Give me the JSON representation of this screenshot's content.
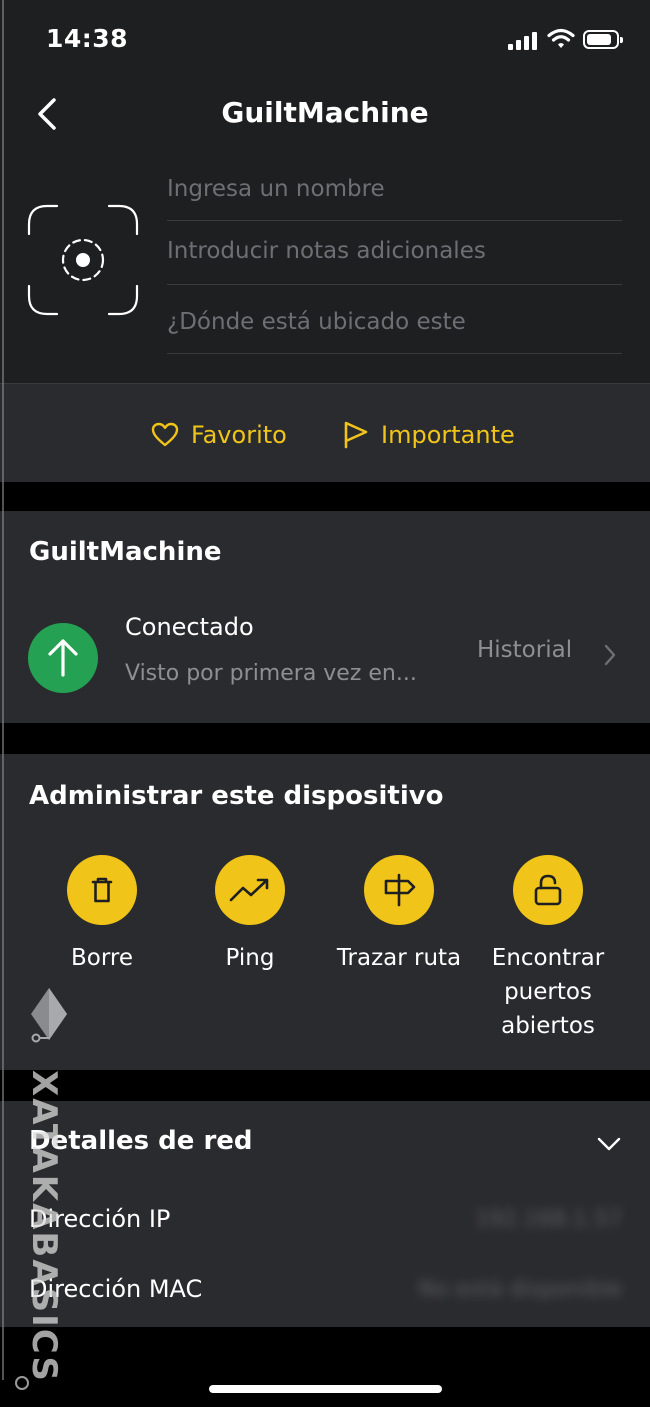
{
  "status_bar": {
    "time": "14:38"
  },
  "header": {
    "title": "GuiltMachine",
    "name_placeholder": "Ingresa un nombre",
    "notes_placeholder": "Introducir notas adicionales",
    "location_placeholder": "¿Dónde está ubicado este"
  },
  "actions_row": {
    "favorite": "Favorito",
    "important": "Importante"
  },
  "device_card": {
    "title": "GuiltMachine",
    "status": "Conectado",
    "subtitle": "Visto por primera vez en...",
    "history": "Historial"
  },
  "manage": {
    "title": "Administrar este dispositivo",
    "actions": [
      {
        "label": "Borre",
        "icon": "trash-icon"
      },
      {
        "label": "Ping",
        "icon": "trend-up-icon"
      },
      {
        "label": "Trazar ruta",
        "icon": "signpost-icon"
      },
      {
        "label": "Encontrar puertos abiertos",
        "icon": "lock-open-icon"
      }
    ]
  },
  "network": {
    "title": "Detalles de red",
    "rows": [
      {
        "label": "Dirección IP",
        "value": "192.168.1.57"
      },
      {
        "label": "Dirección MAC",
        "value": "No está disponible"
      }
    ]
  },
  "watermark": {
    "text": "XATAKABASICS"
  },
  "colors": {
    "accent": "#f0c419",
    "connected": "#24a153",
    "card": "#2a2b2e",
    "header": "#1e1f21"
  }
}
